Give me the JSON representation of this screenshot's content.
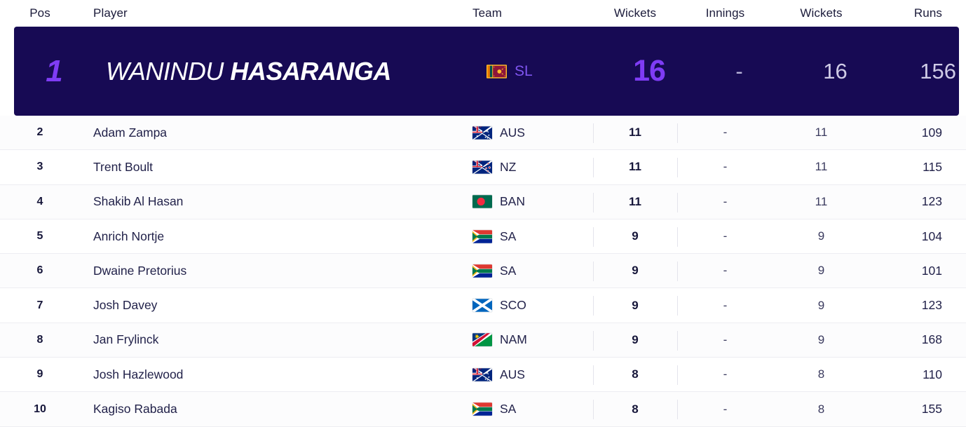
{
  "header": {
    "columns": [
      "Pos",
      "Player",
      "Team",
      "Wickets",
      "Innings",
      "Wickets",
      "Runs"
    ]
  },
  "highlight": {
    "pos": "1",
    "first_name": "WANINDU",
    "last_name": "HASARANGA",
    "team_code": "SL",
    "flag": "sl-flag-icon",
    "wickets": "16",
    "innings": "-",
    "wickets2": "16",
    "runs": "156",
    "accent_color": "#7f3cf5",
    "background_color": "#170a54"
  },
  "rows": [
    {
      "pos": "2",
      "player": "Adam Zampa",
      "team_code": "AUS",
      "flag": "aus-flag-icon",
      "wickets": "11",
      "innings": "-",
      "wickets2": "11",
      "runs": "109"
    },
    {
      "pos": "3",
      "player": "Trent Boult",
      "team_code": "NZ",
      "flag": "nz-flag-icon",
      "wickets": "11",
      "innings": "-",
      "wickets2": "11",
      "runs": "115"
    },
    {
      "pos": "4",
      "player": "Shakib Al Hasan",
      "team_code": "BAN",
      "flag": "ban-flag-icon",
      "wickets": "11",
      "innings": "-",
      "wickets2": "11",
      "runs": "123"
    },
    {
      "pos": "5",
      "player": "Anrich Nortje",
      "team_code": "SA",
      "flag": "sa-flag-icon",
      "wickets": "9",
      "innings": "-",
      "wickets2": "9",
      "runs": "104"
    },
    {
      "pos": "6",
      "player": "Dwaine Pretorius",
      "team_code": "SA",
      "flag": "sa-flag-icon",
      "wickets": "9",
      "innings": "-",
      "wickets2": "9",
      "runs": "101"
    },
    {
      "pos": "7",
      "player": "Josh Davey",
      "team_code": "SCO",
      "flag": "sco-flag-icon",
      "wickets": "9",
      "innings": "-",
      "wickets2": "9",
      "runs": "123"
    },
    {
      "pos": "8",
      "player": "Jan Frylinck",
      "team_code": "NAM",
      "flag": "nam-flag-icon",
      "wickets": "9",
      "innings": "-",
      "wickets2": "9",
      "runs": "168"
    },
    {
      "pos": "9",
      "player": "Josh Hazlewood",
      "team_code": "AUS",
      "flag": "aus-flag-icon",
      "wickets": "8",
      "innings": "-",
      "wickets2": "8",
      "runs": "110"
    },
    {
      "pos": "10",
      "player": "Kagiso Rabada",
      "team_code": "SA",
      "flag": "sa-flag-icon",
      "wickets": "8",
      "innings": "-",
      "wickets2": "8",
      "runs": "155"
    }
  ]
}
